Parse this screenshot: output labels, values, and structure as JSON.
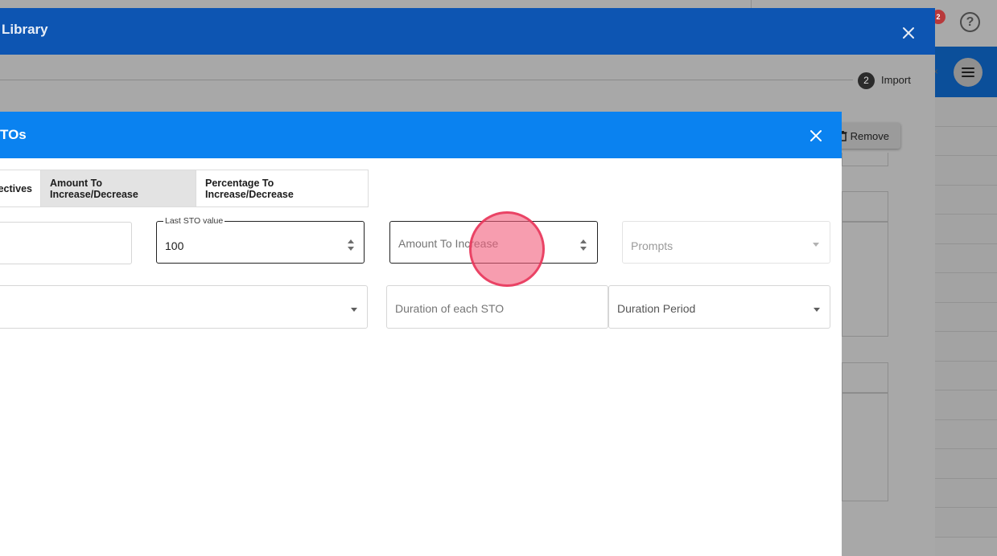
{
  "background": {
    "notification_count": "2",
    "help_icon": "help-circle-icon",
    "menu_icon": "hamburger-menu-icon"
  },
  "outer_modal": {
    "title": "Library",
    "close_icon": "close-icon",
    "import": {
      "count": "2",
      "label": "Import"
    },
    "remove_label": "Remove",
    "remove_icon": "trash-icon"
  },
  "sto_modal": {
    "title": "TOs",
    "close_icon": "close-icon",
    "tabs": [
      {
        "label": "ectives",
        "selected": false
      },
      {
        "label": "Amount To Increase/Decrease",
        "selected": true
      },
      {
        "label": "Percentage To Increase/Decrease",
        "selected": false
      }
    ],
    "fields": {
      "last_sto_value": {
        "label": "Last STO value",
        "value": "100"
      },
      "amount_to_increase": {
        "placeholder": "Amount To Increase"
      },
      "prompts": {
        "placeholder": "Prompts"
      },
      "duration_each_sto": {
        "placeholder": "Duration of each STO"
      },
      "duration_period": {
        "placeholder": "Duration Period"
      }
    }
  },
  "colors": {
    "outer_header": "#0d55b2",
    "inner_header": "#0a82f0",
    "click_marker": "#f25c7a"
  }
}
